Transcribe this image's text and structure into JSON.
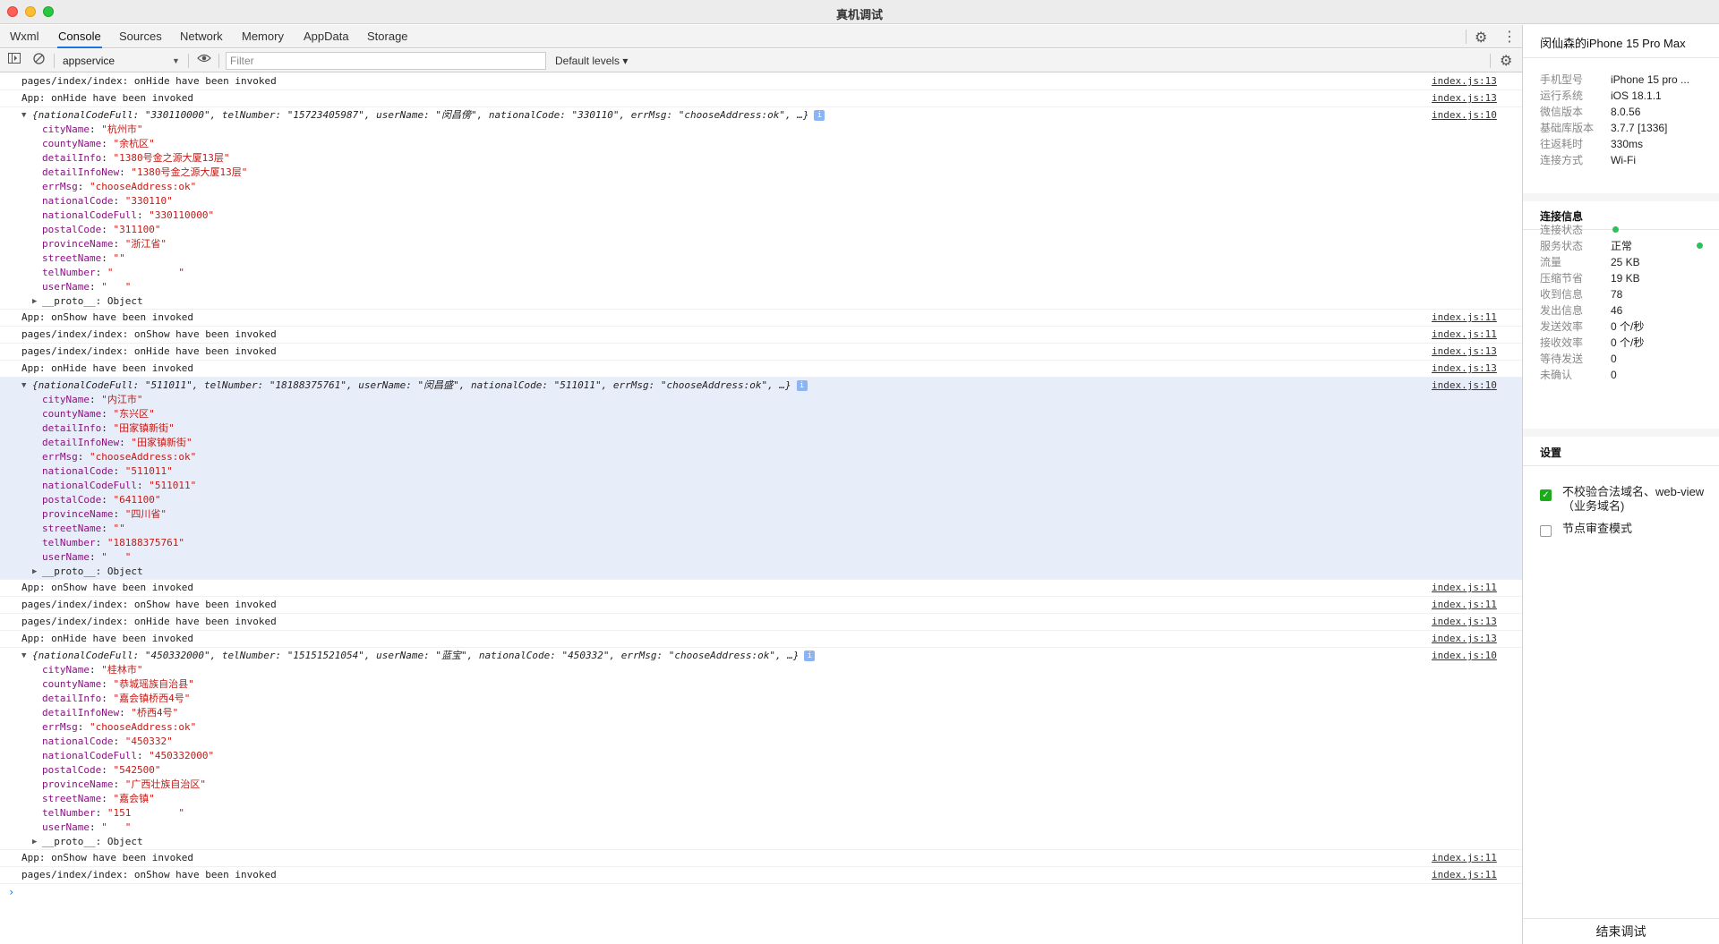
{
  "window": {
    "title": "真机调试"
  },
  "tabs": [
    {
      "label": "Wxml"
    },
    {
      "label": "Console"
    },
    {
      "label": "Sources"
    },
    {
      "label": "Network"
    },
    {
      "label": "Memory"
    },
    {
      "label": "AppData"
    },
    {
      "label": "Storage"
    }
  ],
  "toolbar": {
    "context": "appservice",
    "filter_placeholder": "Filter",
    "levels": "Default levels ▾"
  },
  "console": {
    "logs1": [
      {
        "msg": "pages/index/index: onHide have been invoked",
        "src": "index.js:13"
      },
      {
        "msg": "App: onHide have been invoked",
        "src": "index.js:13"
      }
    ],
    "obj1": {
      "head": "{nationalCodeFull: \"330110000\", telNumber: \"15723405987\", userName: \"闵昌傍\", nationalCode: \"330110\", errMsg: \"chooseAddress:ok\", …}",
      "src": "index.js:10",
      "props": [
        {
          "k": "cityName",
          "v": "\"杭州市\""
        },
        {
          "k": "countyName",
          "v": "\"余杭区\""
        },
        {
          "k": "detailInfo",
          "v": "\"1380号金之源大厦13层\""
        },
        {
          "k": "detailInfoNew",
          "v": "\"1380号金之源大厦13层\""
        },
        {
          "k": "errMsg",
          "v": "\"chooseAddress:ok\""
        },
        {
          "k": "nationalCode",
          "v": "\"330110\""
        },
        {
          "k": "nationalCodeFull",
          "v": "\"330110000\""
        },
        {
          "k": "postalCode",
          "v": "\"311100\""
        },
        {
          "k": "provinceName",
          "v": "\"浙江省\""
        },
        {
          "k": "streetName",
          "v": "\"\""
        },
        {
          "k": "telNumber",
          "v": "\"           \""
        },
        {
          "k": "userName",
          "v": "\"   \""
        }
      ],
      "proto": "__proto__: Object"
    },
    "logs2": [
      {
        "msg": "App: onShow have been invoked",
        "src": "index.js:11"
      },
      {
        "msg": "pages/index/index: onShow have been invoked",
        "src": "index.js:11"
      },
      {
        "msg": "pages/index/index: onHide have been invoked",
        "src": "index.js:13"
      },
      {
        "msg": "App: onHide have been invoked",
        "src": "index.js:13"
      }
    ],
    "obj2": {
      "head": "{nationalCodeFull: \"511011\", telNumber: \"18188375761\", userName: \"闵昌盛\", nationalCode: \"511011\", errMsg: \"chooseAddress:ok\", …}",
      "src": "index.js:10",
      "props": [
        {
          "k": "cityName",
          "v": "\"内江市\""
        },
        {
          "k": "countyName",
          "v": "\"东兴区\""
        },
        {
          "k": "detailInfo",
          "v": "\"田家镇新街\""
        },
        {
          "k": "detailInfoNew",
          "v": "\"田家镇新街\""
        },
        {
          "k": "errMsg",
          "v": "\"chooseAddress:ok\""
        },
        {
          "k": "nationalCode",
          "v": "\"511011\""
        },
        {
          "k": "nationalCodeFull",
          "v": "\"511011\""
        },
        {
          "k": "postalCode",
          "v": "\"641100\""
        },
        {
          "k": "provinceName",
          "v": "\"四川省\""
        },
        {
          "k": "streetName",
          "v": "\"\""
        },
        {
          "k": "telNumber",
          "v": "\"18188375761\""
        },
        {
          "k": "userName",
          "v": "\"   \""
        }
      ],
      "proto": "__proto__: Object"
    },
    "logs3": [
      {
        "msg": "App: onShow have been invoked",
        "src": "index.js:11"
      },
      {
        "msg": "pages/index/index: onShow have been invoked",
        "src": "index.js:11"
      },
      {
        "msg": "pages/index/index: onHide have been invoked",
        "src": "index.js:13"
      },
      {
        "msg": "App: onHide have been invoked",
        "src": "index.js:13"
      }
    ],
    "obj3": {
      "head": "{nationalCodeFull: \"450332000\", telNumber: \"15151521054\", userName: \"蓝宝\", nationalCode: \"450332\", errMsg: \"chooseAddress:ok\", …}",
      "src": "index.js:10",
      "props": [
        {
          "k": "cityName",
          "v": "\"桂林市\""
        },
        {
          "k": "countyName",
          "v": "\"恭城瑶族自治县\""
        },
        {
          "k": "detailInfo",
          "v": "\"嘉会镇桥西4号\""
        },
        {
          "k": "detailInfoNew",
          "v": "\"桥西4号\""
        },
        {
          "k": "errMsg",
          "v": "\"chooseAddress:ok\""
        },
        {
          "k": "nationalCode",
          "v": "\"450332\""
        },
        {
          "k": "nationalCodeFull",
          "v": "\"450332000\""
        },
        {
          "k": "postalCode",
          "v": "\"542500\""
        },
        {
          "k": "provinceName",
          "v": "\"广西壮族自治区\""
        },
        {
          "k": "streetName",
          "v": "\"嘉会镇\""
        },
        {
          "k": "telNumber",
          "v": "\"151        \""
        },
        {
          "k": "userName",
          "v": "\"   \""
        }
      ],
      "proto": "__proto__: Object"
    },
    "logs4": [
      {
        "msg": "App: onShow have been invoked",
        "src": "index.js:11"
      },
      {
        "msg": "pages/index/index: onShow have been invoked",
        "src": "index.js:11"
      }
    ],
    "prompt": "›"
  },
  "right_panel": {
    "device_title": "闵仙森的iPhone 15 Pro Max",
    "device_info": [
      {
        "k": "手机型号",
        "v": "iPhone 15 pro ..."
      },
      {
        "k": "运行系统",
        "v": "iOS 18.1.1"
      },
      {
        "k": "微信版本",
        "v": "8.0.56"
      },
      {
        "k": "基础库版本",
        "v": "3.7.7 [1336]"
      },
      {
        "k": "往返耗时",
        "v": "330ms"
      },
      {
        "k": "连接方式",
        "v": "Wi-Fi"
      }
    ],
    "conn_title": "连接信息",
    "conn_info": [
      {
        "k": "连接状态",
        "v": ""
      },
      {
        "k": "服务状态",
        "v": "正常"
      },
      {
        "k": "流量",
        "v": "25 KB"
      },
      {
        "k": "压缩节省",
        "v": "19 KB"
      },
      {
        "k": "收到信息",
        "v": "78"
      },
      {
        "k": "发出信息",
        "v": "46"
      },
      {
        "k": "发送效率",
        "v": "0 个/秒"
      },
      {
        "k": "接收效率",
        "v": "0 个/秒"
      },
      {
        "k": "等待发送",
        "v": "0"
      },
      {
        "k": "未确认",
        "v": "0"
      }
    ],
    "settings_title": "设置",
    "settings": [
      {
        "label": "不校验合法域名、web-view（业务域名)",
        "checked": true
      },
      {
        "label": "节点审查模式",
        "checked": false
      }
    ],
    "end_button": "结束调试",
    "status_color": "#2fbf5a"
  }
}
